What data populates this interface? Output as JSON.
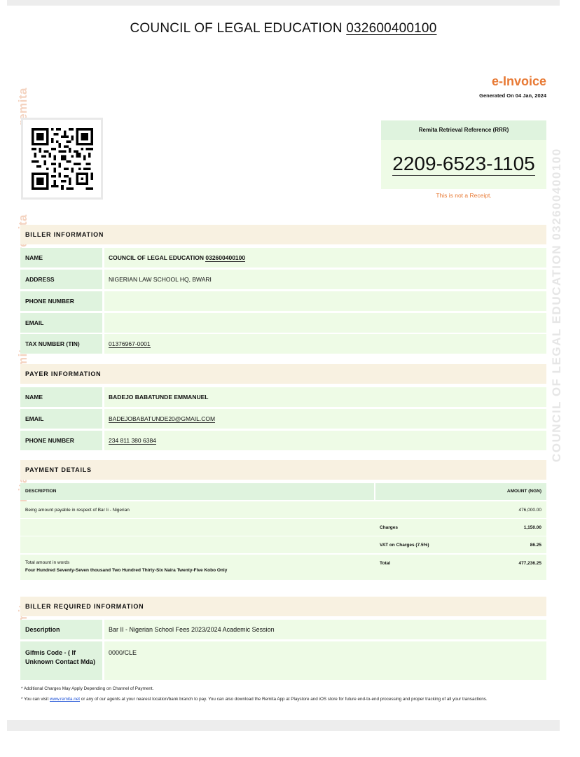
{
  "header": {
    "title": "COUNCIL OF LEGAL EDUCATION",
    "title_code": "032600400100",
    "doc_type": "e-Invoice",
    "generated": "Generated On 04 Jan, 2024"
  },
  "watermarks": {
    "brand": "remita",
    "vertical": "COUNCIL OF LEGAL EDUCATION 032600400100"
  },
  "rrr": {
    "label": "Remita Retrieval Reference (RRR)",
    "number": "2209-6523-1105",
    "note": "This is not a Receipt."
  },
  "biller": {
    "heading": "BILLER INFORMATION",
    "name_label": "NAME",
    "name_value": "COUNCIL OF LEGAL EDUCATION",
    "name_code": "032600400100",
    "address_label": "ADDRESS",
    "address_value": "NIGERIAN LAW SCHOOL HQ, BWARI",
    "phone_label": "PHONE NUMBER",
    "phone_value": "",
    "email_label": "EMAIL",
    "email_value": "",
    "tin_label": "TAX NUMBER (TIN)",
    "tin_value": "01376967-0001"
  },
  "payer": {
    "heading": "PAYER INFORMATION",
    "name_label": "NAME",
    "name_value": "BADEJO BABATUNDE EMMANUEL",
    "email_label": "EMAIL",
    "email_value": "BADEJOBABATUNDE20@GMAIL.COM",
    "phone_label": "PHONE NUMBER",
    "phone_value": "234 811 380 6384"
  },
  "payment": {
    "heading": "PAYMENT DETAILS",
    "col_desc": "DESCRIPTION",
    "col_amount": "AMOUNT (NGN)",
    "item_desc": "Being amount payable in respect of Bar Ii - Nigerian",
    "item_amount": "476,000.00",
    "charges_label": "Charges",
    "charges_amount": "1,150.00",
    "vat_label": "VAT on Charges (7.5%)",
    "vat_amount": "86.25",
    "words_label": "Total amount in words",
    "words_value": "Four Hundred Seventy-Seven thousand Two Hundred Thirty-Six Naira Twenty-Five Kobo Only",
    "total_label": "Total",
    "total_amount": "477,236.25"
  },
  "required": {
    "heading": "BILLER REQUIRED INFORMATION",
    "desc_label": "Description",
    "desc_value": "Bar II - Nigerian School Fees 2023/2024 Academic Session",
    "gifmis_label": "Gifmis Code - ( If Unknown Contact Mda)",
    "gifmis_value": "0000/CLE"
  },
  "notes": {
    "note1": "* Additional Charges May Apply Depending on Channel of Payment.",
    "note2_pre": "* You can visit ",
    "note2_link": "www.remita.net",
    "note2_post": " or any of our agents at your nearest location/bank branch to pay. You can also download the Remita App at Playstore and iOS store for future end-to-end processing and proper tracking of all your transactions."
  }
}
